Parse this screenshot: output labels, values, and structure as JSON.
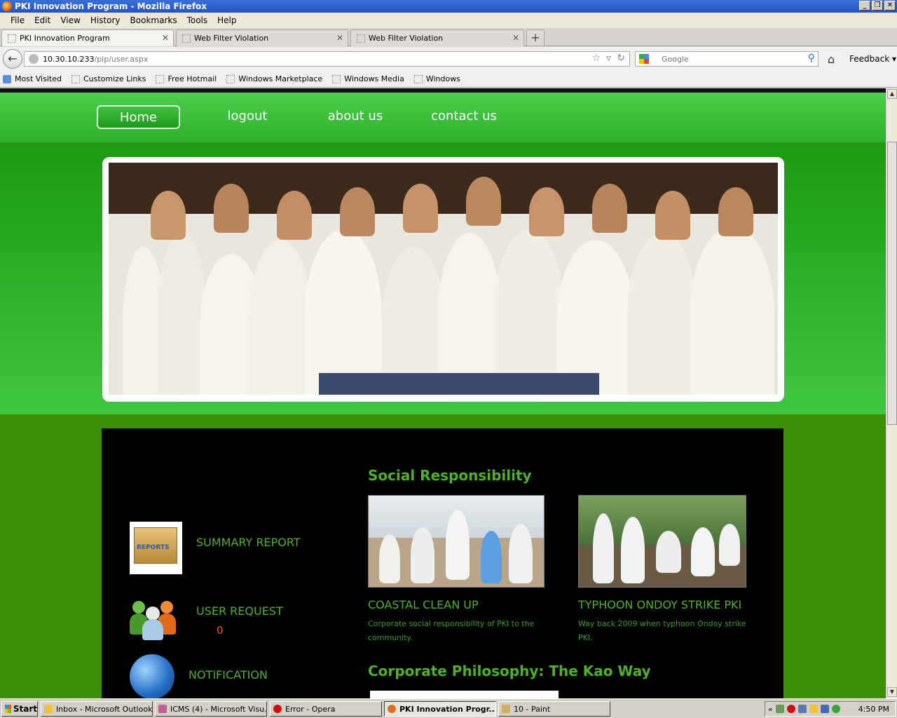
{
  "window": {
    "title": "PKI Innovation Program - Mozilla Firefox",
    "controls": [
      "_",
      "❐",
      "✕"
    ]
  },
  "menu": [
    "File",
    "Edit",
    "View",
    "History",
    "Bookmarks",
    "Tools",
    "Help"
  ],
  "tabs": [
    {
      "label": "PKI Innovation Program",
      "active": true
    },
    {
      "label": "Web Filter Violation",
      "active": false
    },
    {
      "label": "Web Filter Violation",
      "active": false
    }
  ],
  "address": {
    "host": "10.30.10.233",
    "path": "/pip/user.aspx"
  },
  "search": {
    "placeholder": "Google"
  },
  "feedback_label": "Feedback",
  "bookmarks": [
    "Most Visited",
    "Customize Links",
    "Free Hotmail",
    "Windows Marketplace",
    "Windows Media",
    "Windows"
  ],
  "site_nav": [
    "Home",
    "logout",
    "about us",
    "contact us"
  ],
  "sidebar": {
    "summary_report": "SUMMARY REPORT",
    "report_icon_text": "REPORTS",
    "user_request": "USER REQUEST",
    "user_request_count": "0",
    "notification": "NOTIFICATION"
  },
  "main": {
    "social_title": "Social Responsibility",
    "cards": [
      {
        "title": "COASTAL CLEAN UP",
        "text": "Corporate social responsibility of PKI to the community."
      },
      {
        "title": "TYPHOON ONDOY STRIKE PKI",
        "text": "Way back 2009 when typhoon Ondoy strike PKI."
      }
    ],
    "philosophy_title": "Corporate Philosophy: The Kao Way"
  },
  "taskbar": {
    "start": "Start",
    "tasks": [
      {
        "label": "Inbox - Microsoft Outlook",
        "active": false
      },
      {
        "label": "ICMS (4) - Microsoft Visu...",
        "active": false
      },
      {
        "label": "Error - Opera",
        "active": false
      },
      {
        "label": "PKI Innovation Progr...",
        "active": true
      },
      {
        "label": "10 - Paint",
        "active": false
      }
    ],
    "clock": "4:50 PM"
  },
  "colors": {
    "site_green": "#2cb12c",
    "accent_text": "#4fb02a",
    "count_orange": "#e05a10",
    "panel_bg": "#000000"
  }
}
